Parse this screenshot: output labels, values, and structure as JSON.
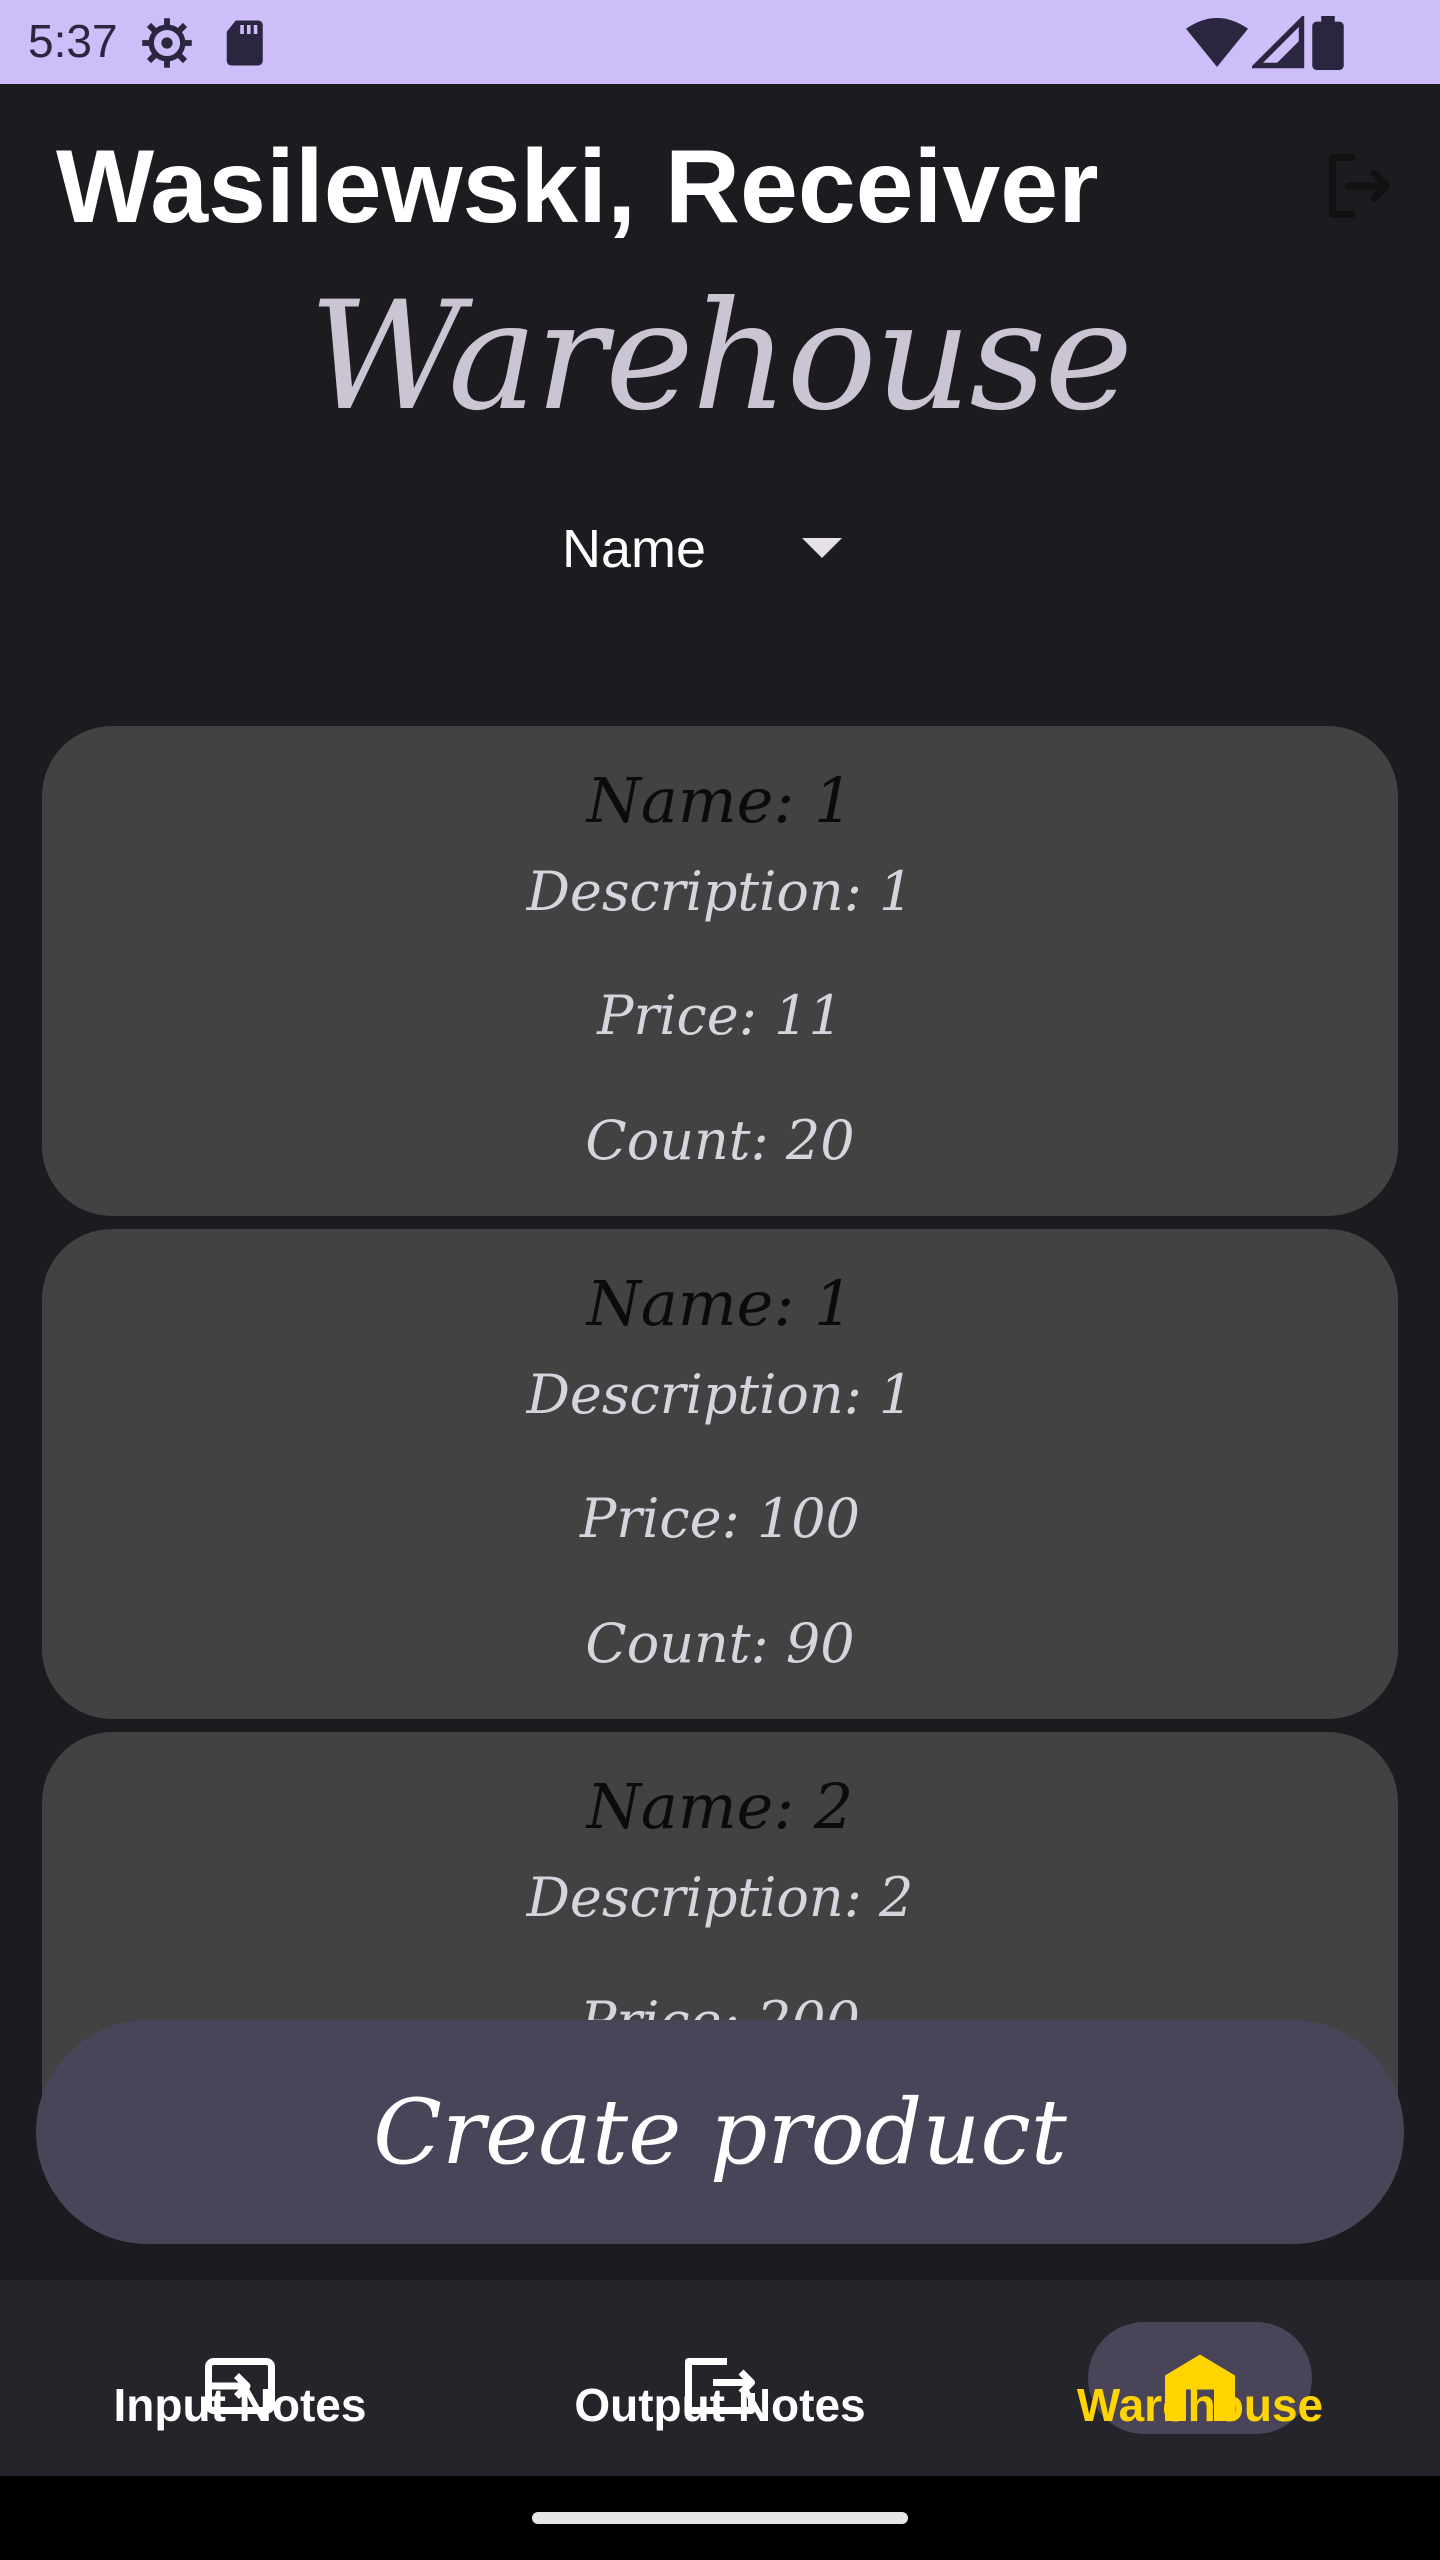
{
  "status_bar": {
    "time": "5:37",
    "icons": [
      "settings-icon",
      "sd-card-icon",
      "wifi-icon",
      "cell-signal-icon",
      "battery-icon"
    ]
  },
  "header": {
    "user_title": "Wasilewski, Receiver",
    "logout_icon": "logout-icon"
  },
  "screen_title": "Warehouse",
  "sort": {
    "selected": "Name"
  },
  "products": [
    {
      "name": "Name: 1",
      "description": "Description: 1",
      "price": "Price: 11",
      "count": "Count: 20"
    },
    {
      "name": "Name: 1",
      "description": "Description: 1",
      "price": "Price: 100",
      "count": "Count: 90"
    },
    {
      "name": "Name: 2",
      "description": "Description: 2",
      "price": "Price: 200",
      "count": ""
    }
  ],
  "create_button": "Create product",
  "nav": {
    "items": [
      {
        "label": "Input Notes",
        "icon": "input-notes-icon",
        "active": false
      },
      {
        "label": "Output Notes",
        "icon": "output-notes-icon",
        "active": false
      },
      {
        "label": "Warehouse",
        "icon": "warehouse-icon",
        "active": true
      }
    ]
  },
  "colors": {
    "status_bar": "#cdbdf9",
    "background": "#1c1b20",
    "card": "#424242",
    "button": "#4a4459",
    "active_nav": "#ffd400"
  }
}
